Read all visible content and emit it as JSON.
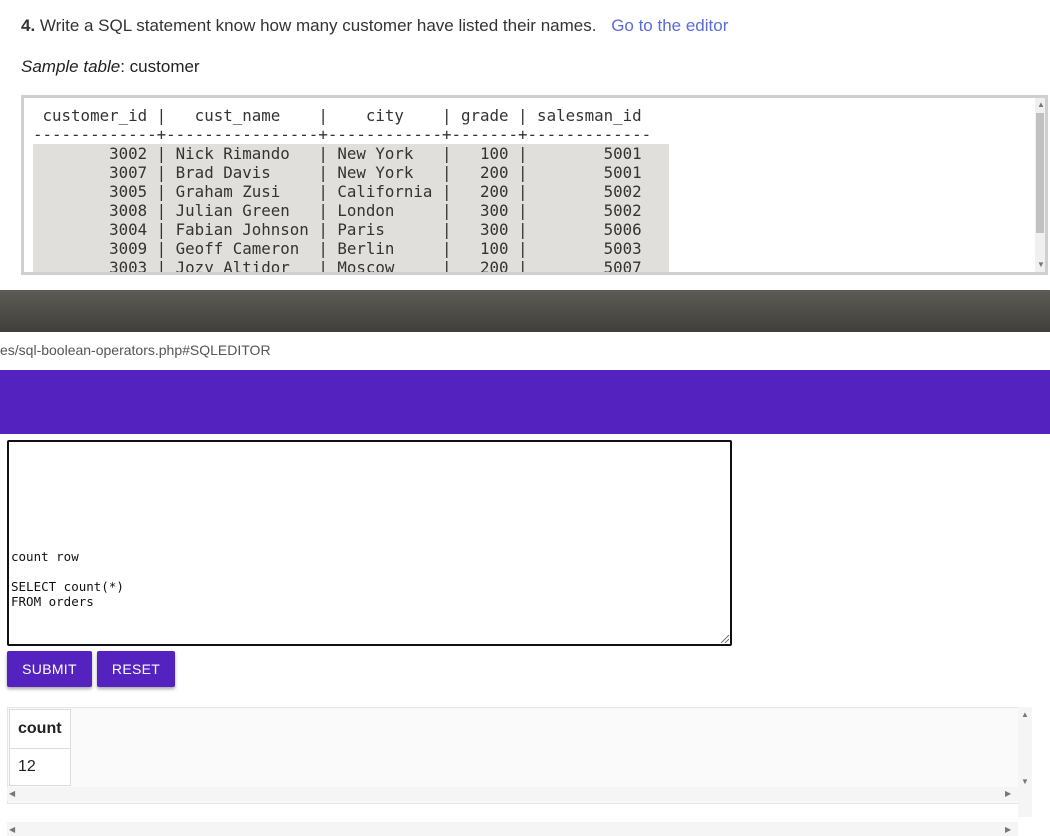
{
  "question": {
    "number": "4.",
    "text": "Write a SQL statement know how many customer have listed their names.",
    "editor_link": "Go to the editor"
  },
  "sample": {
    "label": "Sample table",
    "table_name": ": customer"
  },
  "sample_table_text": " customer_id |   cust_name    |    city    | grade | salesman_id\n-------------+----------------+------------+-------+-------------\n        3002 | Nick Rimando   | New York   |   100 |        5001\n        3007 | Brad Davis     | New York   |   200 |        5001\n        3005 | Graham Zusi    | California |   200 |        5002\n        3008 | Julian Green   | London     |   300 |        5002\n        3004 | Fabian Johnson | Paris      |   300 |        5006\n        3009 | Geoff Cameron  | Berlin     |   100 |        5003\n        3003 | Jozy Altidor   | Moscow     |   200 |        5007",
  "url": "es/sql-boolean-operators.php#SQLEDITOR",
  "editor_text": "count row\n\nSELECT count(*)\nFROM orders",
  "buttons": {
    "submit": "SUBMIT",
    "reset": "RESET"
  },
  "result": {
    "header": "count",
    "value": "12"
  },
  "colors": {
    "accent_purple": "#5423bf",
    "link_blue": "#5a6bdb"
  }
}
